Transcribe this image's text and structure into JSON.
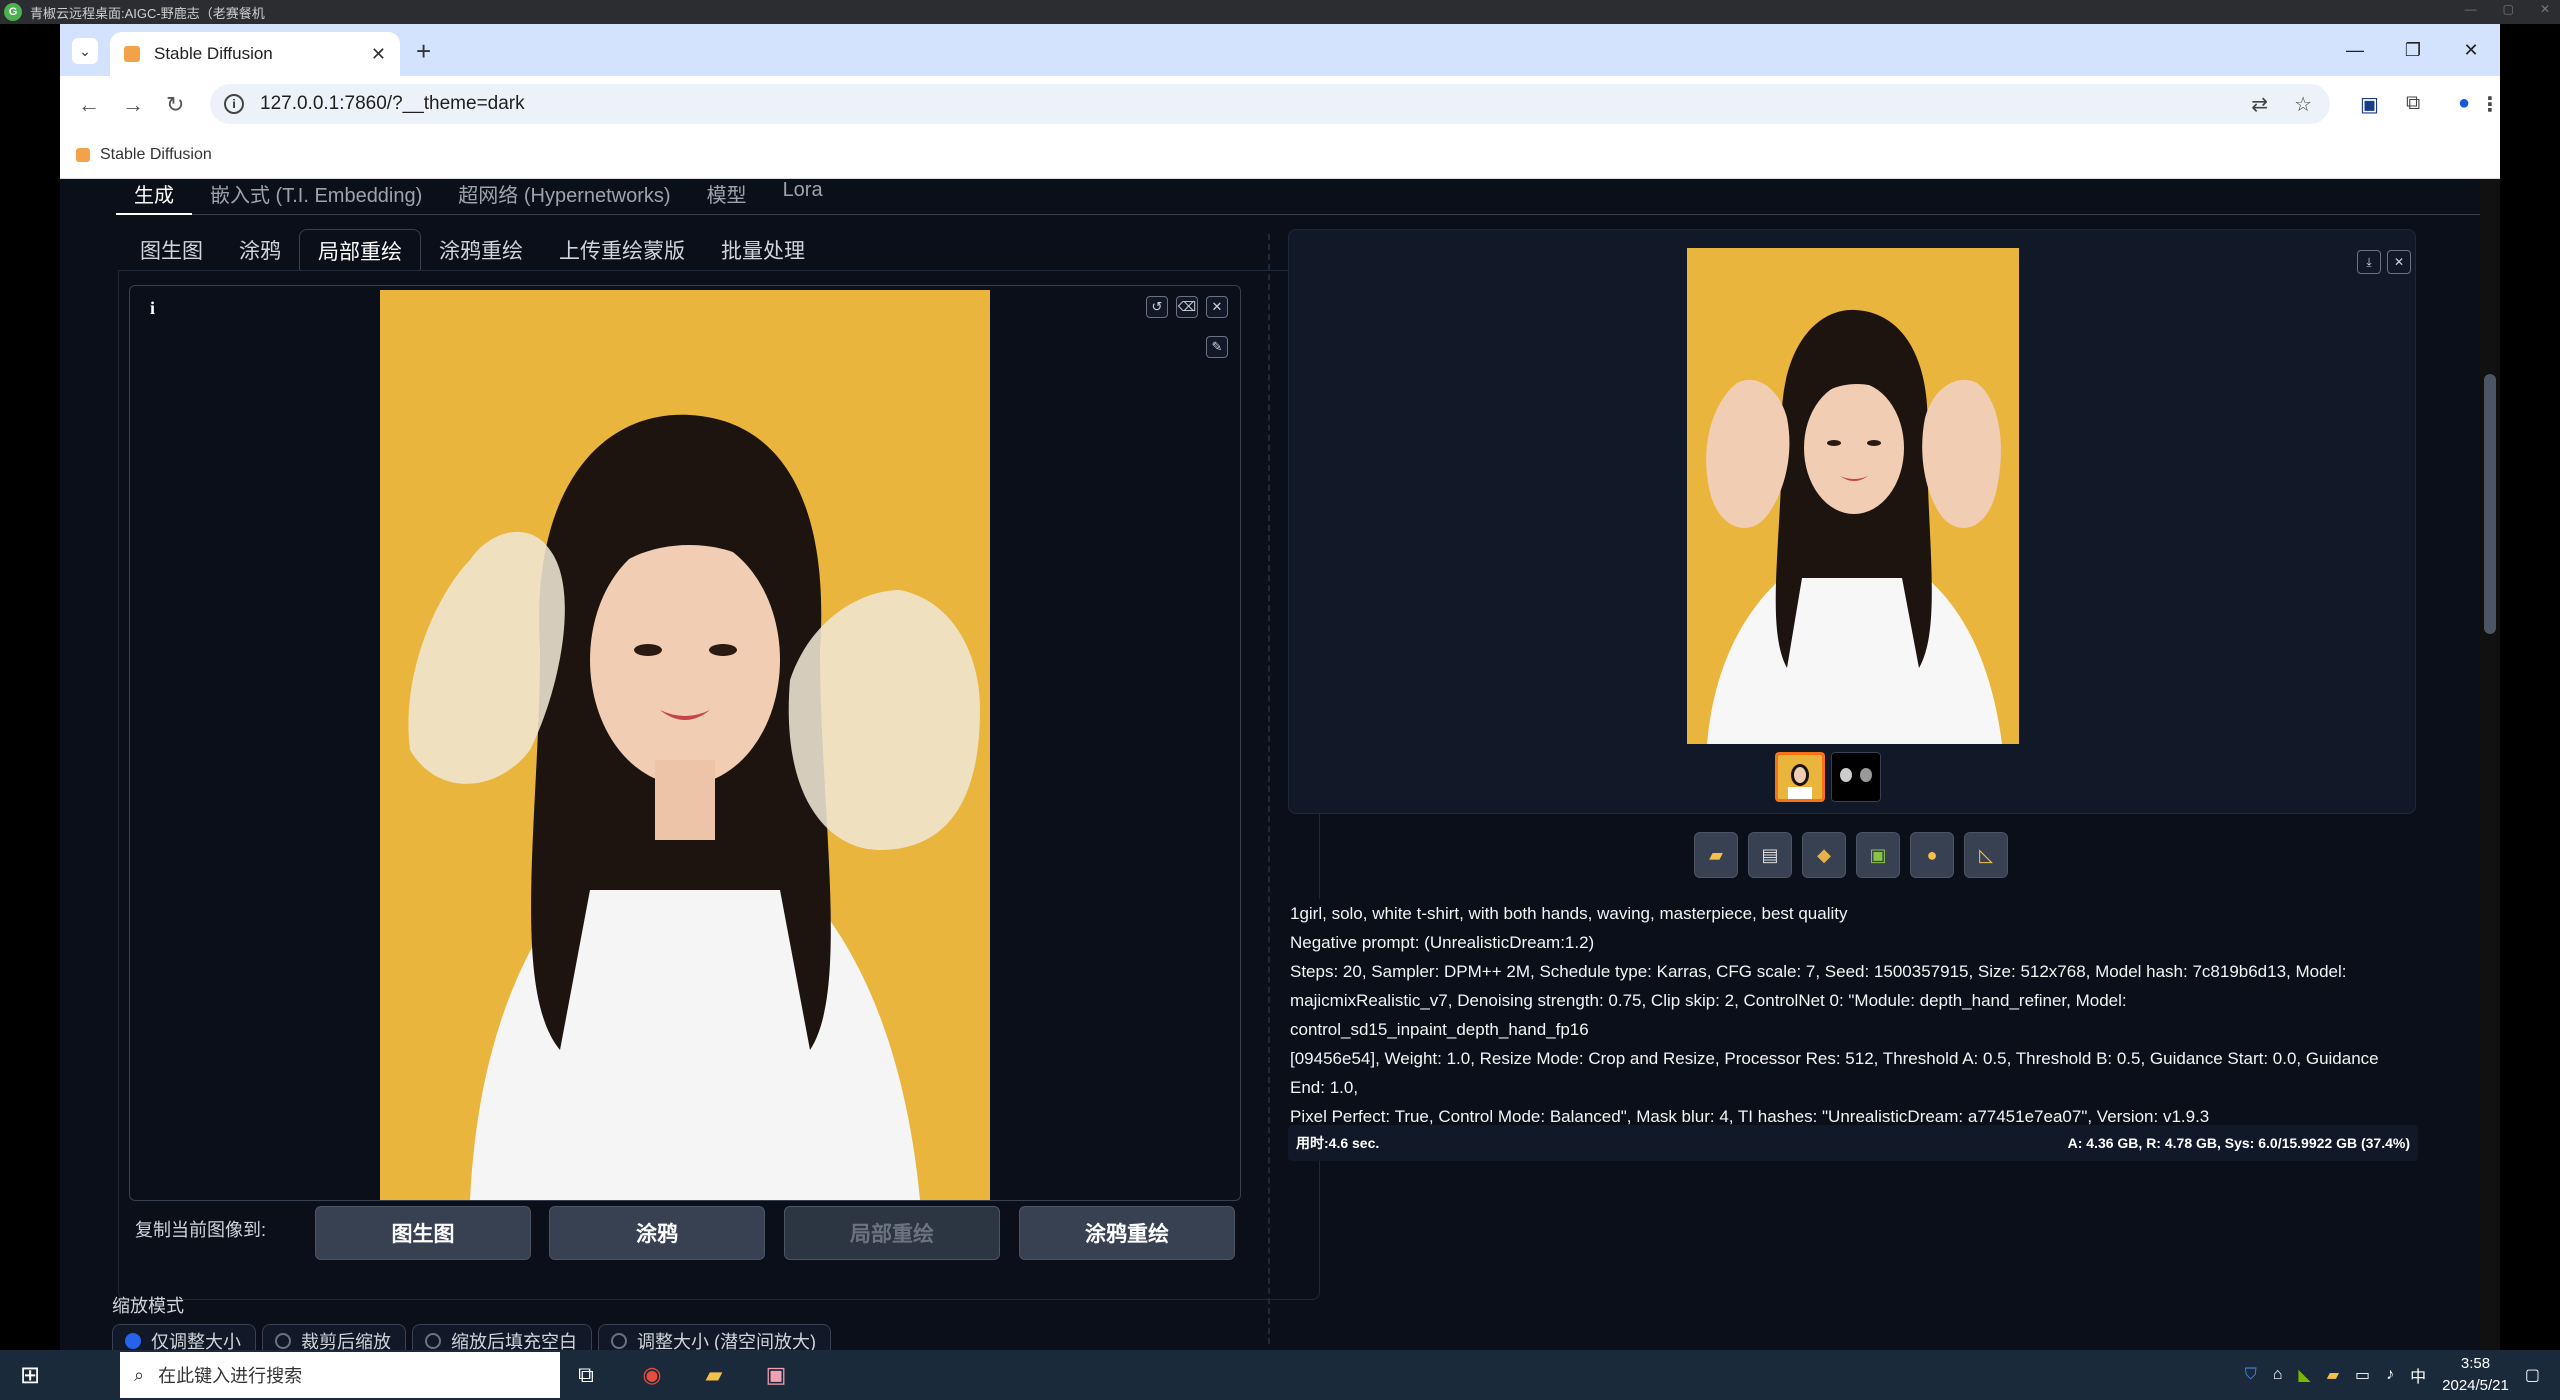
{
  "remote_title": "青椒云远程桌面:AIGC-野鹿志（老赛餐机",
  "browser": {
    "tab_title": "Stable Diffusion",
    "url": "127.0.0.1:7860/?__theme=dark",
    "bookmark": "Stable Diffusion"
  },
  "webui": {
    "main_tabs": [
      "生成",
      "嵌入式 (T.I. Embedding)",
      "超网络 (Hypernetworks)",
      "模型",
      "Lora"
    ],
    "sub_tabs": [
      "图生图",
      "涂鸦",
      "局部重绘",
      "涂鸦重绘",
      "上传重绘蒙版",
      "批量处理"
    ],
    "active_sub_tab": "局部重绘",
    "canvas_info": "i",
    "copy_to_label": "复制当前图像到:",
    "copy_buttons": [
      "图生图",
      "涂鸦",
      "局部重绘",
      "涂鸦重绘"
    ],
    "scale_mode_label": "缩放模式",
    "scale_modes": [
      "仅调整大小",
      "裁剪后缩放",
      "缩放后填充空白",
      "调整大小 (潜空间放大)"
    ],
    "info_lines": [
      "1girl, solo, white t-shirt, with both hands, waving, masterpiece, best quality",
      "Negative prompt: (UnrealisticDream:1.2)",
      "Steps: 20, Sampler: DPM++ 2M, Schedule type: Karras, CFG scale: 7, Seed: 1500357915, Size: 512x768, Model hash: 7c819b6d13, Model:",
      "majicmixRealistic_v7, Denoising strength: 0.75, Clip skip: 2, ControlNet 0: \"Module: depth_hand_refiner, Model: control_sd15_inpaint_depth_hand_fp16",
      "[09456e54], Weight: 1.0, Resize Mode: Crop and Resize, Processor Res: 512, Threshold A: 0.5, Threshold B: 0.5, Guidance Start: 0.0, Guidance End: 1.0,",
      "Pixel Perfect: True, Control Mode: Balanced\", Mask blur: 4, TI hashes: \"UnrealisticDream: a77451e7ea07\", Version: v1.9.3"
    ],
    "time_taken": "用时:4.6 sec.",
    "memory": "A: 4.36 GB, R: 4.78 GB, Sys: 6.0/15.9922 GB (37.4%)"
  },
  "taskbar": {
    "search_placeholder": "在此键入进行搜索",
    "ime": "中",
    "time": "3:58",
    "date": "2024/5/21"
  },
  "colors": {
    "bg": "#0b0f19",
    "accent": "#f97316",
    "photo_bg": "#e9b53c"
  }
}
